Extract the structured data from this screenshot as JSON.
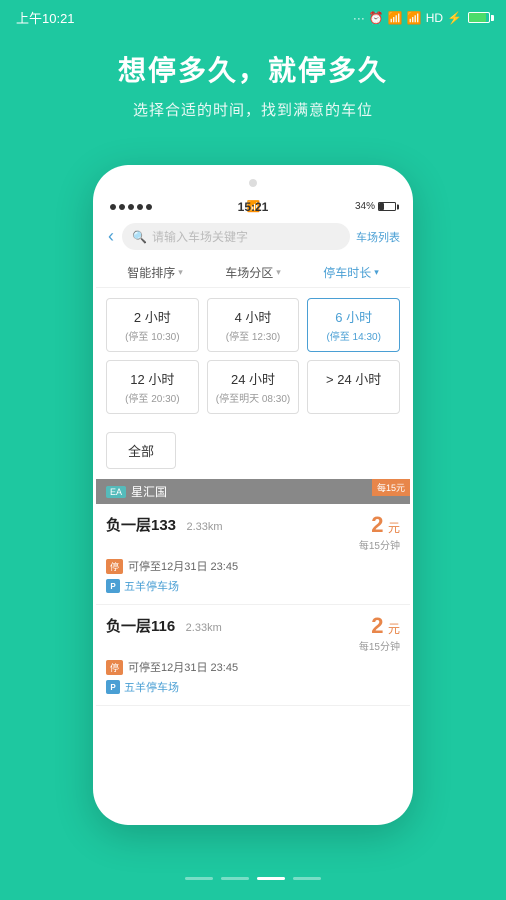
{
  "statusBar": {
    "time": "上午10:21",
    "batteryPercent": "34%",
    "hdLabel": "HD"
  },
  "hero": {
    "title": "想停多久，就停多久",
    "subtitle": "选择合适的时间，找到满意的车位"
  },
  "phone": {
    "innerTime": "15:21",
    "innerBattery": "34%",
    "searchPlaceholder": "请输入车场关键字",
    "parkListBtn": "车场列表",
    "backArrow": "‹",
    "searchIconChar": "🔍"
  },
  "filters": [
    {
      "label": "智能排序",
      "active": false
    },
    {
      "label": "车场分区",
      "active": false
    },
    {
      "label": "停车时长",
      "active": true
    }
  ],
  "timeOptions": [
    [
      {
        "main": "2 小时",
        "sub": "(停至 10:30)",
        "selected": false,
        "label": "2-hour"
      },
      {
        "main": "4 小时",
        "sub": "(停至 12:30)",
        "selected": false,
        "label": "4-hour"
      },
      {
        "main": "6 小时",
        "sub": "(停至 14:30)",
        "selected": true,
        "label": "6-hour"
      }
    ],
    [
      {
        "main": "12 小时",
        "sub": "(停至 20:30)",
        "selected": false,
        "label": "12-hour"
      },
      {
        "main": "24 小时",
        "sub": "(停至明天 08:30)",
        "selected": false,
        "label": "24-hour"
      },
      {
        "main": "> 24 小时",
        "sub": "",
        "selected": false,
        "label": "over-24-hour"
      }
    ]
  ],
  "allBtn": "全部",
  "parkListHeader": {
    "tagLabel": "EA",
    "name": "星汇国",
    "priceBadge": "每15元"
  },
  "parkCards": [
    {
      "id": "card1",
      "name": "负一层133",
      "distance": "2.33km",
      "canParkUntil": "可停至12月31日 23:45",
      "tagColor": "orange",
      "tagLabel": "停",
      "lotIconLabel": "P",
      "lotName": "五羊停车场",
      "price": "2",
      "priceUnit": "元",
      "pricePer": "每15分钟"
    },
    {
      "id": "card2",
      "name": "负一层116",
      "distance": "2.33km",
      "canParkUntil": "可停至12月31日 23:45",
      "tagColor": "orange",
      "tagLabel": "停",
      "lotIconLabel": "P",
      "lotName": "五羊停车场",
      "price": "2",
      "priceUnit": "元",
      "pricePer": "每15分钟"
    }
  ],
  "bottomDots": [
    {
      "active": false
    },
    {
      "active": false
    },
    {
      "active": true
    },
    {
      "active": false
    }
  ]
}
